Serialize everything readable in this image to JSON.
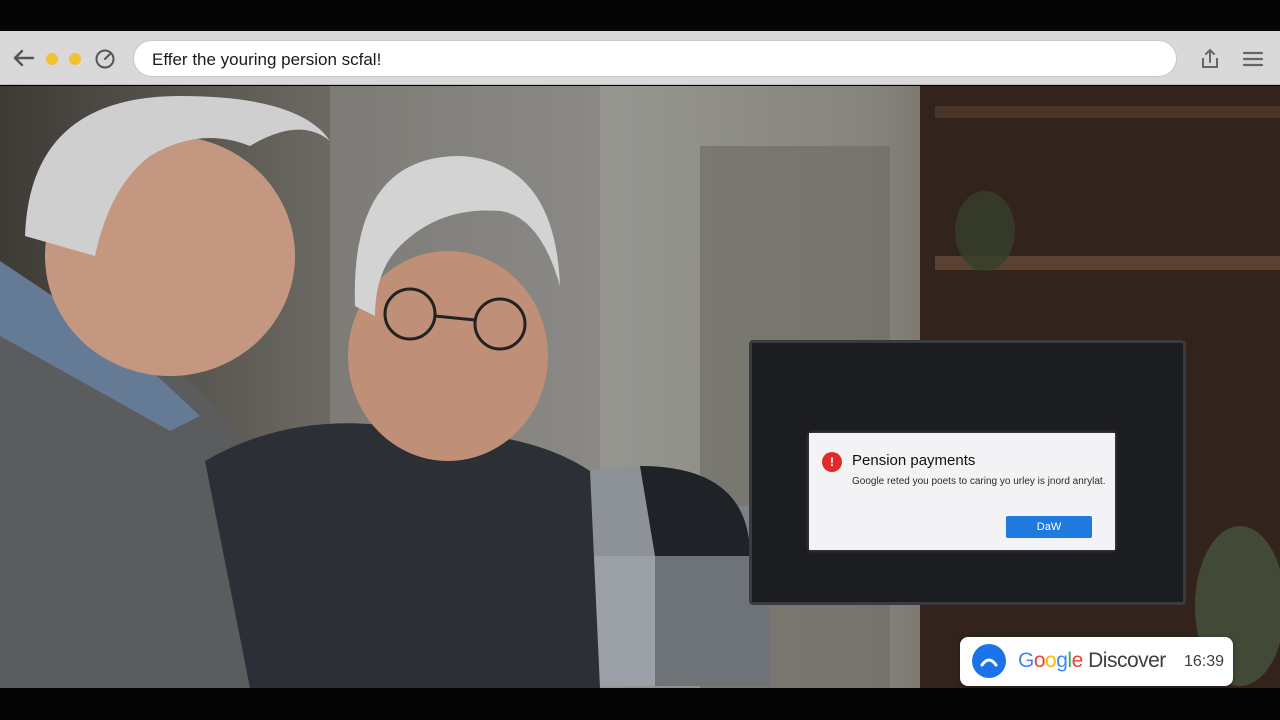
{
  "browser": {
    "address_text": "Effer the youring persion scfal!"
  },
  "dialog": {
    "title": "Pension payments",
    "body": "Google reted you poets to caring yo urley is jnord anrylat.",
    "button_label": "DaW",
    "alert_icon": "!"
  },
  "discover_badge": {
    "brand": [
      "G",
      "o",
      "o",
      "g",
      "l",
      "e"
    ],
    "label": "Discover",
    "time": "16:39"
  },
  "colors": {
    "url_bar": "#ffffff",
    "chrome": "#d9d9d9",
    "dialog_button": "#1f7ae0",
    "alert_red": "#e02b2b",
    "window_dots": "#f2c230"
  },
  "icons": [
    "back-arrow-icon",
    "window-dot-icon",
    "reload-icon",
    "share-icon",
    "hamburger-menu-icon",
    "alert-icon",
    "discover-icon"
  ]
}
